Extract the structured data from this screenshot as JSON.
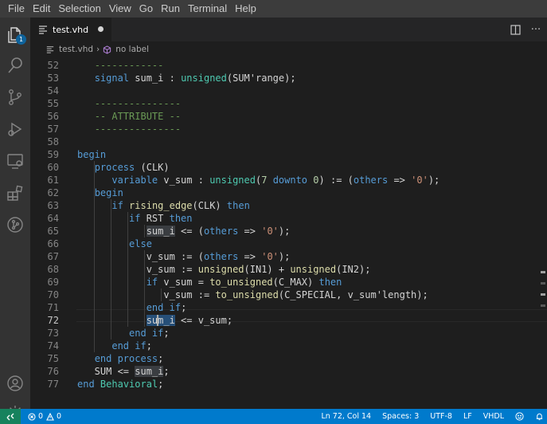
{
  "menu": [
    "File",
    "Edit",
    "Selection",
    "View",
    "Go",
    "Run",
    "Terminal",
    "Help"
  ],
  "activity": {
    "explorer_badge": "1",
    "icons": [
      "files-icon",
      "search-icon",
      "source-control-icon",
      "run-debug-icon",
      "remote-explorer-icon",
      "extensions-icon",
      "git-graph-icon",
      "account-icon",
      "settings-gear-icon"
    ]
  },
  "tab": {
    "label": "test.vhd",
    "modified": true
  },
  "breadcrumb": {
    "file": "test.vhd",
    "symbol": "no label"
  },
  "editor": {
    "current_line": 72,
    "line_numbers": [
      52,
      53,
      54,
      55,
      56,
      57,
      58,
      59,
      60,
      61,
      62,
      63,
      64,
      65,
      66,
      67,
      68,
      69,
      70,
      71,
      72,
      73,
      74,
      75,
      76,
      77
    ]
  },
  "status": {
    "errors": "0",
    "warnings": "0",
    "position": "Ln 72, Col 14",
    "spaces": "Spaces: 3",
    "encoding": "UTF-8",
    "eol": "LF",
    "language": "VHDL"
  },
  "colors": {
    "statusbar": "#007acc",
    "remote": "#16825d",
    "editor_bg": "#1e1e1e",
    "activity_bg": "#333333"
  }
}
